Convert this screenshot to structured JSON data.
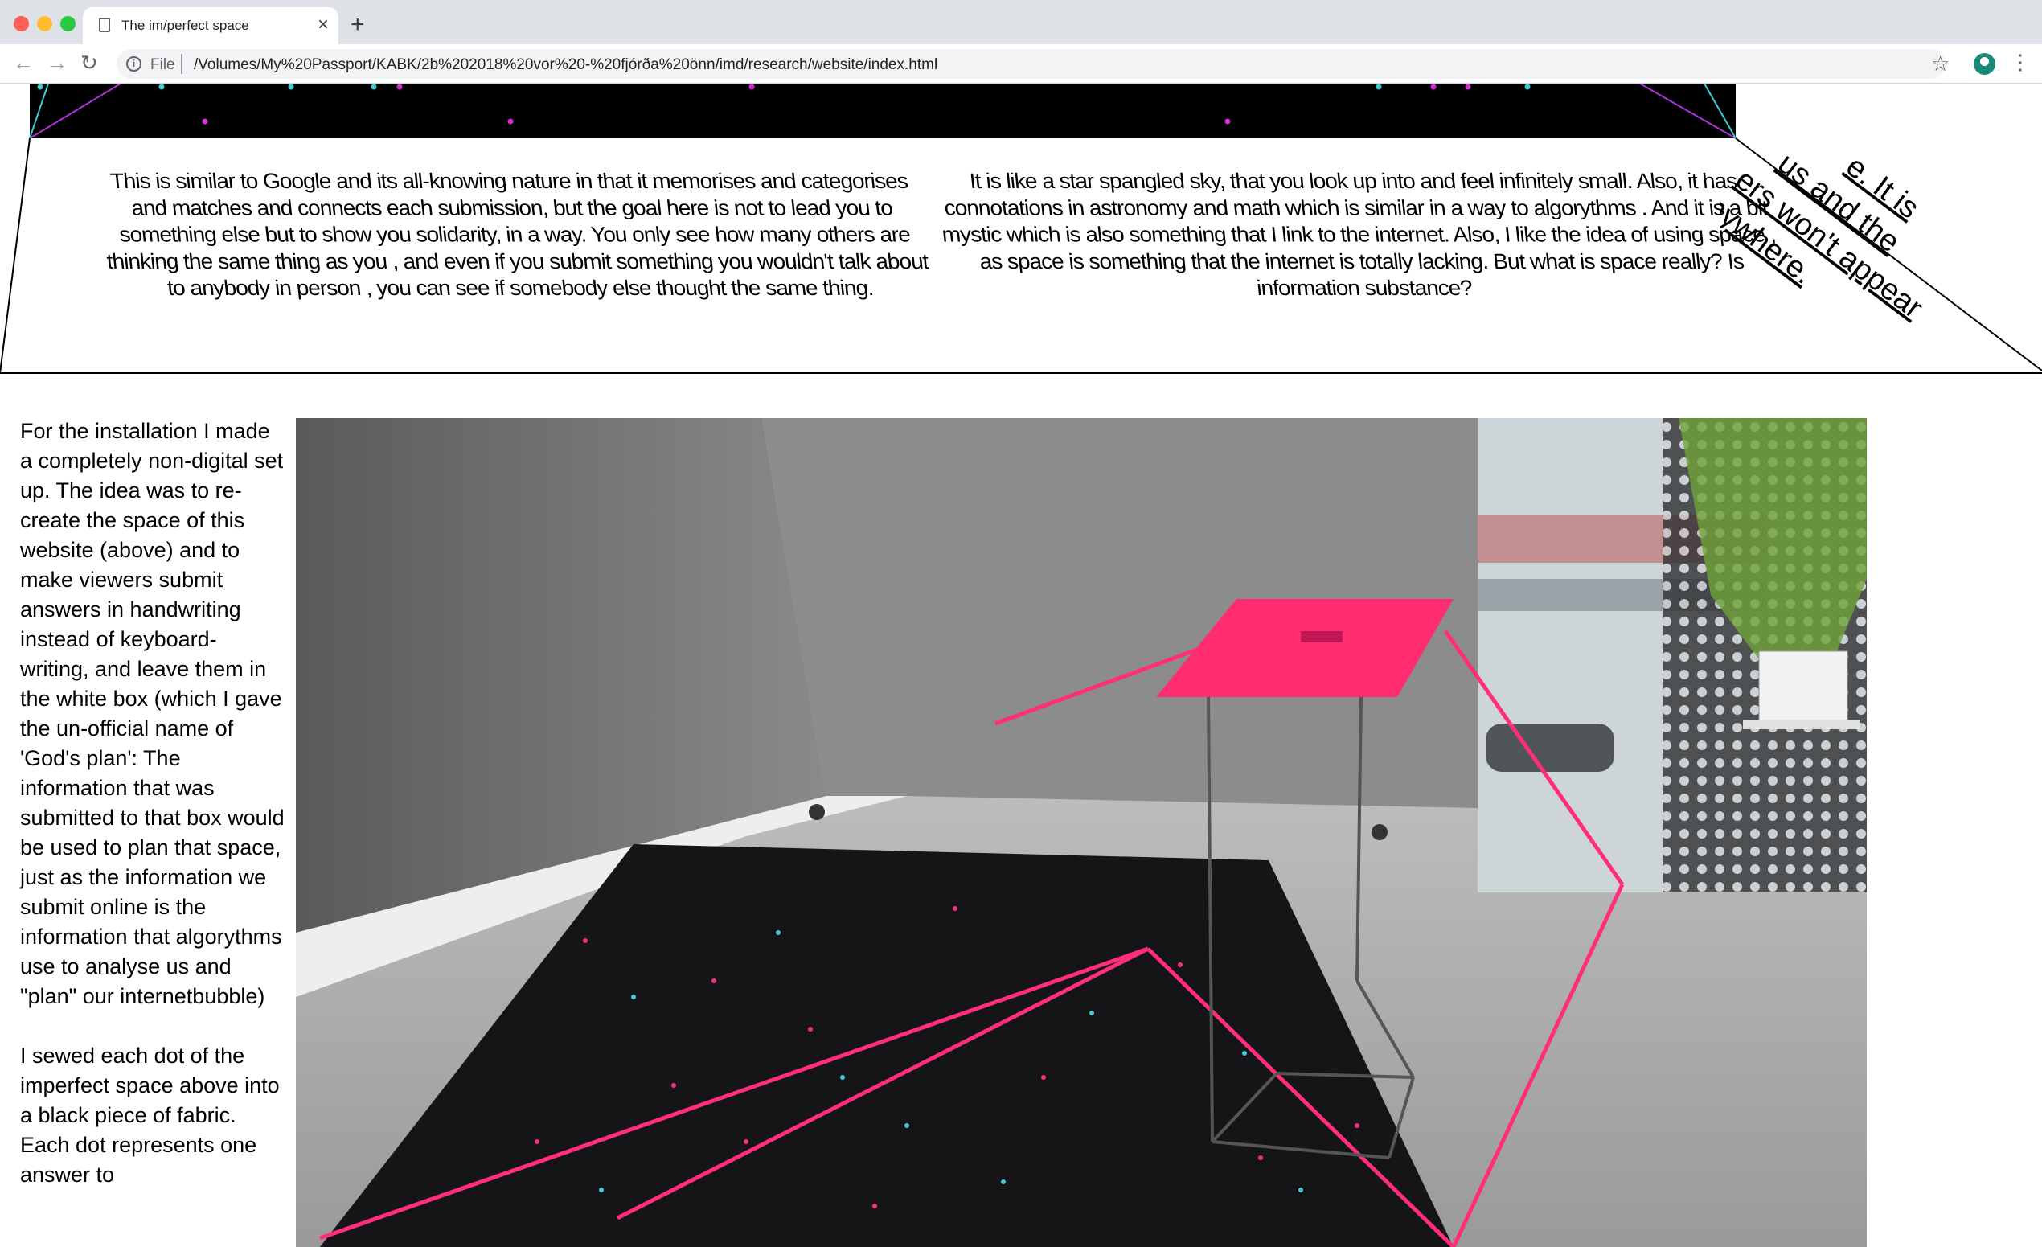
{
  "browser": {
    "tab_title": "The im/perfect space",
    "tab_close": "×",
    "new_tab": "+",
    "url_scheme": "File",
    "url": "/Volumes/My%20Passport/KABK/2b%202018%20vor%20-%20fjórða%20önn/imd/research/website/index.html",
    "icons": [
      "back-arrow-icon",
      "forward-arrow-icon",
      "reload-icon",
      "info-icon",
      "star-icon",
      "profile-icon",
      "menu-icon"
    ]
  },
  "page": {
    "left_panel_text": "This is similar to Google and its all-knowing nature in that it memorises and categorises and matches and connects each submission, but the goal here is not to lead you to something else but to show you solidarity, in a way. You only see how many others are thinking the same thing as you , and even if you submit something you wouldn't talk about to anybody in person , you can see if somebody else thought the same thing.",
    "center_panel_text": "It is like a star spangled sky, that you look up into and feel infinitely small. Also, it has connotations in astronomy and math which is similar in a way to algorythms . And it is a bit mystic which is also something that I link to the internet. Also, I like the idea of using space , as space is something that the internet is totally lacking. But what is space really? Is information substance?",
    "right_panel_lines": [
      "e. It is",
      "us and the",
      "ers won't appear",
      "anywhere."
    ],
    "body_paragraphs": [
      "For the installation I made a completely non-digital set up. The idea was to re-create the space of this website (above) and to make viewers submit answers in handwriting instead of keyboard-writing, and leave them in the white box (which I gave the un-official name of 'God's plan': The information that was submitted to that box would be used to plan that space, just as the information we submit online is the information that algorythms use to analyse us and \"plan\" our internetbubble)",
      "I sewed each dot of the imperfect space above into a black piece of fabric. Each dot represents one answer to"
    ],
    "colors": {
      "magenta": "#ff2d7a",
      "cyan": "#3ecbd6",
      "dot_magenta": "#d42bd8",
      "black": "#000000"
    }
  }
}
